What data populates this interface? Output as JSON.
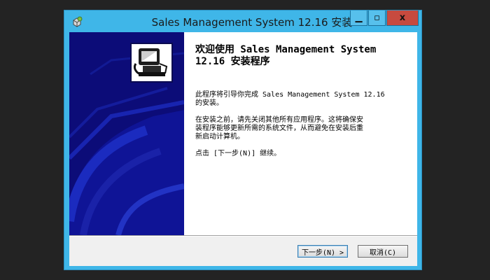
{
  "window": {
    "title": "Sales Management System 12.16 安装",
    "controls": {
      "minimize": "▁",
      "maximize": "▫",
      "close": "x"
    }
  },
  "icons": {
    "app_icon": "installer-app-icon",
    "logo": "computer-install-logo"
  },
  "content": {
    "heading": "欢迎使用 Sales Management System\n12.16 安装程序",
    "paragraph1": "此程序将引导你完成 Sales Management System 12.16\n的安装。",
    "paragraph2": "在安装之前，请先关闭其他所有应用程序。这将确保安\n装程序能够更新所需的系统文件，从而避免在安装后重\n新启动计算机。",
    "paragraph3": "点击 [下一步(N)] 继续。"
  },
  "buttons": {
    "next": "下一步(N) >",
    "cancel": "取消(C)"
  },
  "colors": {
    "titlebar": "#3fb6e8",
    "close": "#c74a3f",
    "sidebar": "#0c0c78"
  }
}
